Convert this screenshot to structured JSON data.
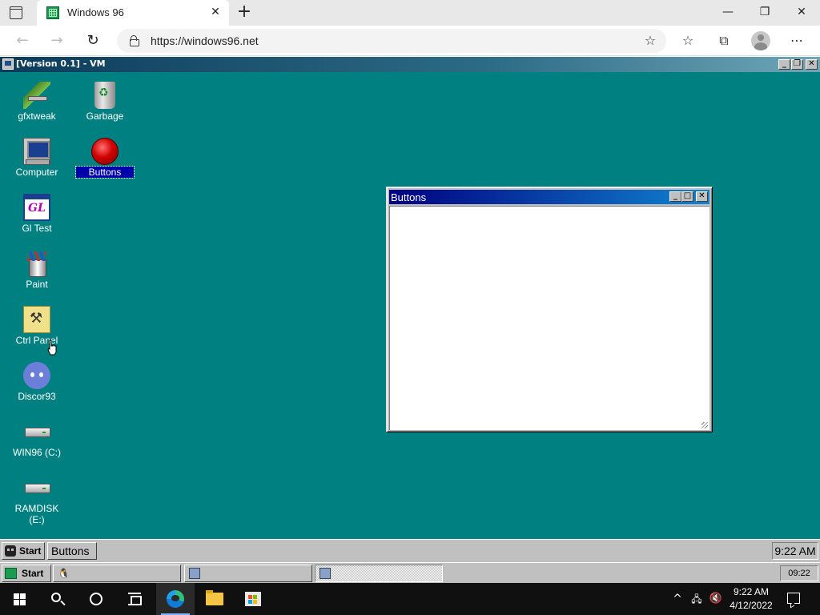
{
  "browser": {
    "tab_title": "Windows 96",
    "tab_close": "✕",
    "new_tab": "+",
    "url": "https://windows96.net",
    "window_controls": {
      "minimize": "—",
      "restore": "❐",
      "close": "✕"
    }
  },
  "vm_window": {
    "title": "[Version 0.1] - VM",
    "controls": {
      "minimize": "_",
      "restore": "❐",
      "close": "✕"
    }
  },
  "desktop": {
    "background": "#008080",
    "icons": [
      {
        "label": "gfxtweak",
        "icon": "gfxtweak-icon"
      },
      {
        "label": "Garbage",
        "icon": "trash-icon"
      },
      {
        "label": "Computer",
        "icon": "computer-icon"
      },
      {
        "label": "Buttons",
        "icon": "red-button-icon",
        "selected": true
      },
      {
        "label": "Gl Test",
        "icon": "gl-test-icon"
      },
      {
        "label": "Paint",
        "icon": "paint-icon"
      },
      {
        "label": "Ctrl Panel",
        "icon": "control-panel-icon"
      },
      {
        "label": "Discor93",
        "icon": "discord-icon"
      },
      {
        "label": "WIN96 (C:)",
        "icon": "drive-icon"
      },
      {
        "label": "RAMDISK (E:)",
        "icon": "drive-icon"
      }
    ]
  },
  "buttons_window": {
    "title": "Buttons",
    "controls": {
      "minimize": "_",
      "maximize": "□",
      "close": "✕"
    }
  },
  "win96_taskbar": {
    "start_label": "Start",
    "tasks": [
      "Buttons"
    ],
    "clock": "9:22 AM"
  },
  "host_taskbar": {
    "start_label": "Start",
    "clock": "09:22"
  },
  "windows_taskbar": {
    "time": "9:22 AM",
    "date": "4/12/2022"
  }
}
